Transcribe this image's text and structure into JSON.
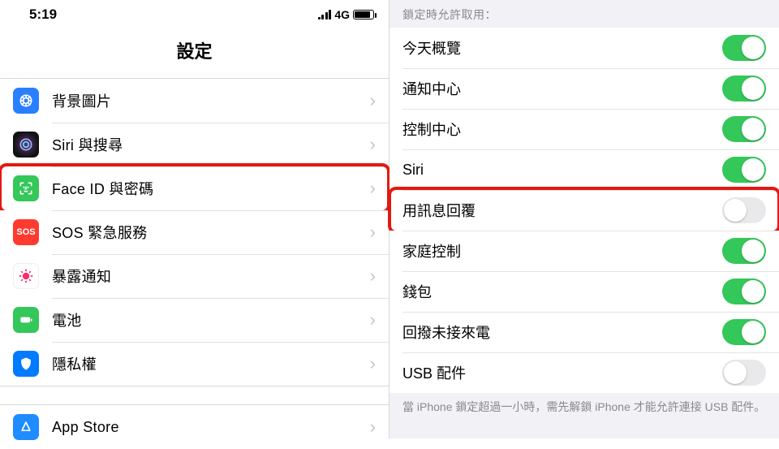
{
  "status": {
    "time": "5:19",
    "network": "4G"
  },
  "left": {
    "title": "設定",
    "group1": [
      {
        "icon": "wallpaper-icon",
        "color": "bg-blue",
        "label": "背景圖片"
      },
      {
        "icon": "siri-icon",
        "color": "bg-black",
        "label": "Siri 與搜尋"
      },
      {
        "icon": "faceid-icon",
        "color": "bg-green",
        "label": "Face ID 與密碼",
        "highlight": true
      },
      {
        "icon": "sos-icon",
        "color": "bg-red",
        "label": "SOS 緊急服務",
        "text": "SOS"
      },
      {
        "icon": "exposure-icon",
        "color": "bg-white",
        "label": "暴露通知"
      },
      {
        "icon": "battery-icon",
        "color": "bg-battery",
        "label": "電池"
      },
      {
        "icon": "privacy-icon",
        "color": "bg-blue2",
        "label": "隱私權"
      }
    ],
    "group2": [
      {
        "icon": "appstore-icon",
        "color": "bg-appst",
        "label": "App Store"
      }
    ]
  },
  "right": {
    "header": "鎖定時允許取用：",
    "items": [
      {
        "label": "今天概覽",
        "on": true
      },
      {
        "label": "通知中心",
        "on": true
      },
      {
        "label": "控制中心",
        "on": true
      },
      {
        "label": "Siri",
        "on": true
      },
      {
        "label": "用訊息回覆",
        "on": false,
        "highlight": true
      },
      {
        "label": "家庭控制",
        "on": true
      },
      {
        "label": "錢包",
        "on": true
      },
      {
        "label": "回撥未接來電",
        "on": true
      },
      {
        "label": "USB 配件",
        "on": false
      }
    ],
    "footer": "當 iPhone 鎖定超過一小時，需先解鎖 iPhone 才能允許連接 USB 配件。"
  }
}
